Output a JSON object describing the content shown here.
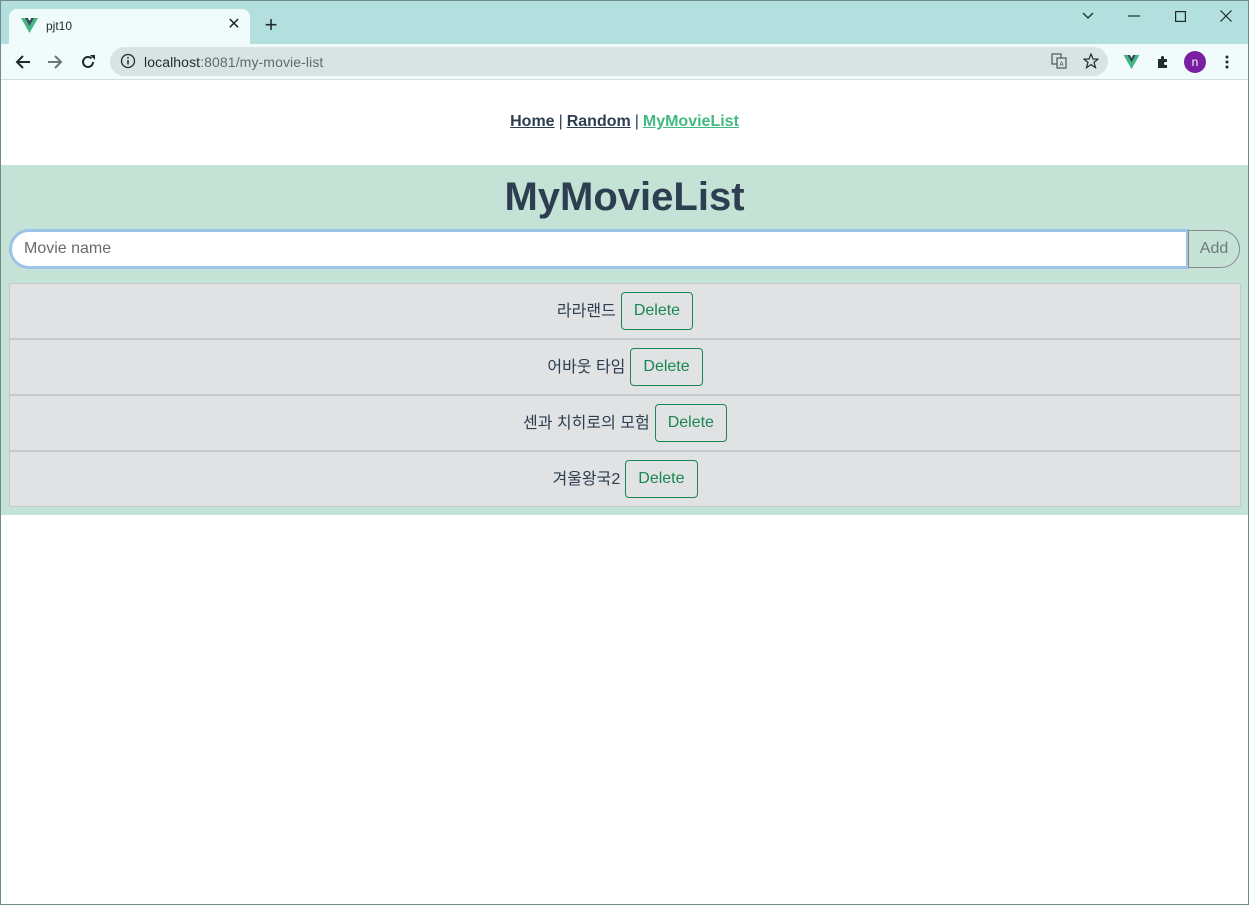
{
  "browser": {
    "tab_title": "pjt10",
    "tab_close": "✕",
    "new_tab": "+",
    "url_host": "localhost",
    "url_rest": ":8081/my-movie-list",
    "profile_initial": "n"
  },
  "nav": {
    "home": "Home",
    "random": "Random",
    "mymovielist": "MyMovieList",
    "separator": "|"
  },
  "main": {
    "title": "MyMovieList",
    "input_placeholder": "Movie name",
    "input_value": "",
    "add_label": "Add",
    "delete_label": "Delete",
    "movies": [
      "라라랜드",
      "어바웃 타임",
      "센과 치히로의 모험",
      "겨울왕국2"
    ]
  },
  "colors": {
    "accent": "#42b983",
    "text": "#2c3e50",
    "panel_bg": "#c5e2d6",
    "delete_border": "#198754"
  }
}
